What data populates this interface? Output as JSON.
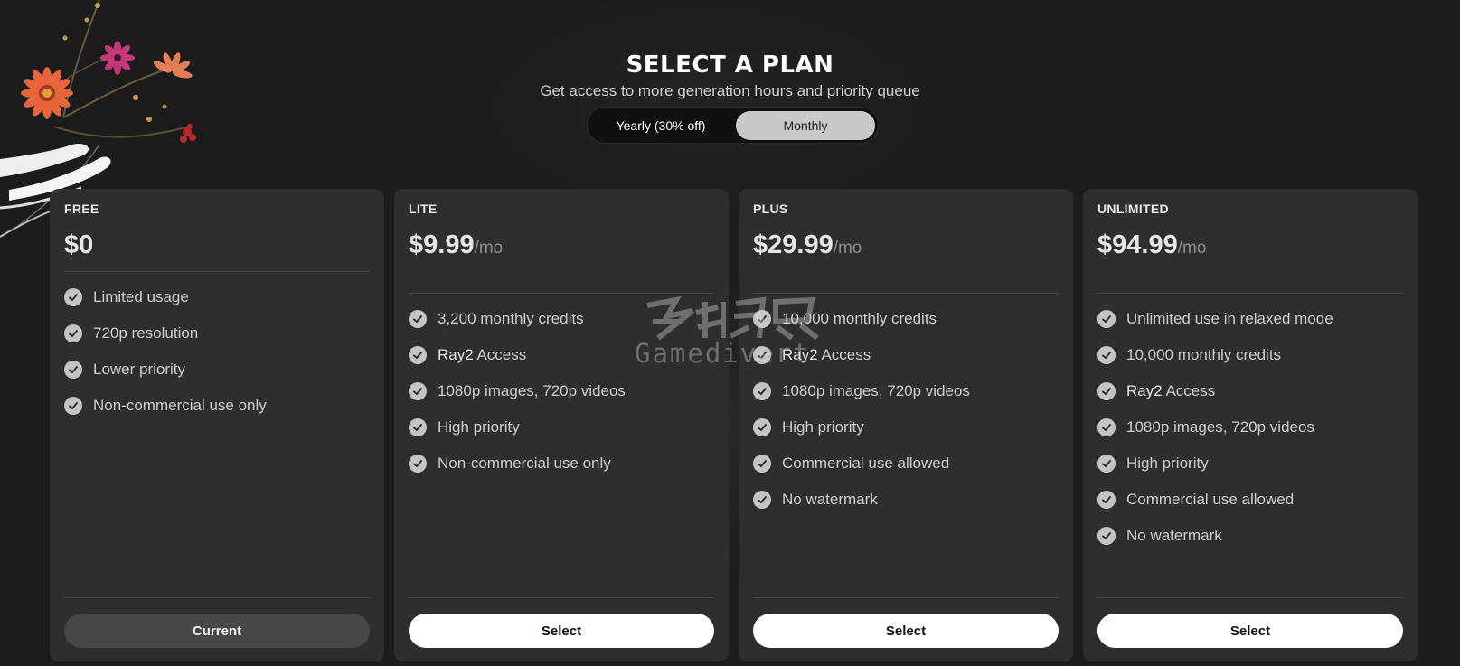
{
  "header": {
    "title": "SELECT A PLAN",
    "subtitle": "Get access to more generation hours and priority queue"
  },
  "billing_toggle": {
    "options": [
      "Yearly (30% off)",
      "Monthly"
    ],
    "selected": "Monthly"
  },
  "plans": [
    {
      "name": "FREE",
      "price": "$0",
      "period": "",
      "features": [
        {
          "text": "Limited usage"
        },
        {
          "text": "720p resolution"
        },
        {
          "text": "Lower priority"
        },
        {
          "text": "Non-commercial use only"
        }
      ],
      "button": "Current"
    },
    {
      "name": "LITE",
      "price": "$9.99",
      "period": "/mo",
      "features": [
        {
          "text": "3,200 monthly credits"
        },
        {
          "highlight": "Ray2",
          "text": " Access"
        },
        {
          "text": "1080p images, 720p videos"
        },
        {
          "text": "High priority"
        },
        {
          "text": "Non-commercial use only"
        }
      ],
      "button": "Select"
    },
    {
      "name": "PLUS",
      "price": "$29.99",
      "period": "/mo",
      "features": [
        {
          "text": "10,000 monthly credits"
        },
        {
          "highlight": "Ray2",
          "text": " Access"
        },
        {
          "text": "1080p images, 720p videos"
        },
        {
          "text": "High priority"
        },
        {
          "text": "Commercial use allowed"
        },
        {
          "text": "No watermark"
        }
      ],
      "button": "Select"
    },
    {
      "name": "UNLIMITED",
      "price": "$94.99",
      "period": "/mo",
      "features": [
        {
          "text": "Unlimited use in relaxed mode"
        },
        {
          "text": "10,000 monthly credits"
        },
        {
          "highlight": "Ray2",
          "text": " Access"
        },
        {
          "text": "1080p images, 720p videos"
        },
        {
          "text": "High priority"
        },
        {
          "text": "Commercial use allowed"
        },
        {
          "text": "No watermark"
        }
      ],
      "button": "Select"
    }
  ],
  "watermark": {
    "cn": "游侠网",
    "en": "Gamedivert"
  },
  "colors": {
    "background": "#1c1c1c",
    "card": "#2e2e2e",
    "toggle_active": "#c9c9c9",
    "button_select": "#ffffff",
    "button_current": "#474747",
    "check": "#c4c4c4"
  }
}
